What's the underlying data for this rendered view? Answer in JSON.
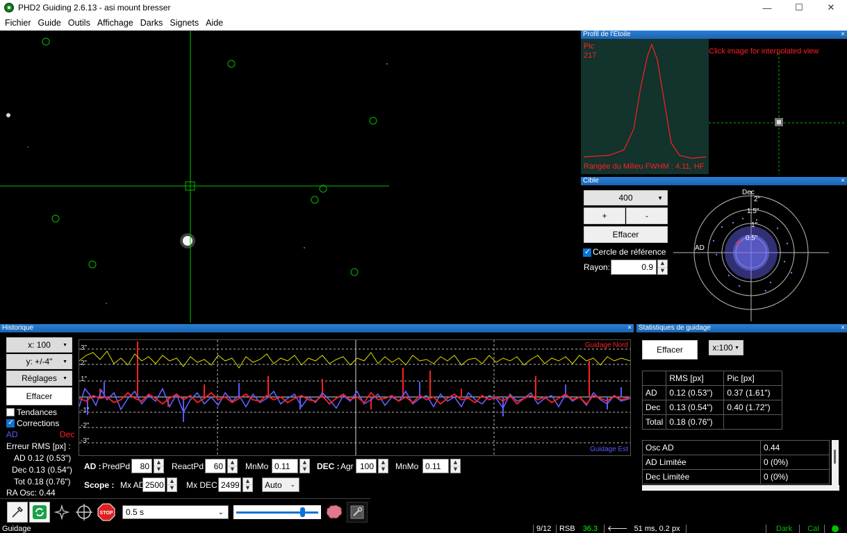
{
  "window": {
    "title": "PHD2 Guiding 2.6.13 - asi mount bresser",
    "minimize": "—",
    "maximize": "☐",
    "close": "✕"
  },
  "menu": [
    "Fichier",
    "Guide",
    "Outils",
    "Affichage",
    "Darks",
    "Signets",
    "Aide"
  ],
  "profile_panel": {
    "title": "Profil de l'Etoile",
    "close": "×",
    "peak_label": "Pic",
    "peak_value": "217",
    "click_hint": "Click image for interpolated view",
    "fwhm_text": "Rangée du Milieu FWHM : 4.11, HF"
  },
  "target_panel": {
    "title": "Cible",
    "close": "×",
    "zoom_value": "400",
    "plus": "+",
    "minus": "-",
    "clear": "Effacer",
    "ref_circle_label": "Cercle de référence",
    "ref_circle_checked": true,
    "radius_label": "Rayon:",
    "radius_value": "0.9",
    "axis_dec": "Dec",
    "axis_ra": "AD",
    "ring_labels": [
      "2\"",
      "1.5\"",
      "1\"",
      "0.5\""
    ]
  },
  "history_panel": {
    "title": "Historique",
    "close": "×",
    "x_scale": "x: 100",
    "y_scale": "y: +/-4\"",
    "settings": "Réglages",
    "clear": "Effacer",
    "trends_label": "Tendances",
    "trends_checked": false,
    "corrections_label": "Corrections",
    "corrections_checked": true,
    "legend_ra": "AD",
    "legend_dec": "Dec",
    "rms_title": "Erreur RMS [px] :",
    "rms_ra": "AD 0.12 (0.53\")",
    "rms_dec": "Dec 0.13 (0.54\")",
    "rms_tot": "Tot 0.18 (0.76\")",
    "ra_osc": "RA Osc: 0.44",
    "graph_north": "Guidage Nord",
    "graph_east": "Guidage Est",
    "y_ticks": [
      "3\"",
      "2\"",
      "1\"",
      "-1\"",
      "-2\"",
      "-3\""
    ],
    "params": {
      "ad_label": "AD :",
      "predpd_label": "PredPd",
      "predpd_value": "80",
      "reactpd_label": "ReactPd",
      "reactpd_value": "60",
      "mnmo_label": "MnMo",
      "mnmo_ra_value": "0.11",
      "dec_label": "DEC :",
      "agr_label": "Agr",
      "agr_value": "100",
      "mnmo_dec_value": "0.11",
      "scope_label": "Scope :",
      "mxad_label": "Mx AD",
      "mxad_value": "2500",
      "mxdec_label": "Mx DEC",
      "mxdec_value": "2499",
      "mode_value": "Auto"
    }
  },
  "stats_panel": {
    "title": "Statistiques de guidage",
    "close": "×",
    "clear": "Effacer",
    "x_scale": "x:100",
    "table_headers": [
      "",
      "RMS [px]",
      "Pic [px]"
    ],
    "table_rows": [
      [
        "AD",
        "0.12 (0.53\")",
        "0.37 (1.61\")"
      ],
      [
        "Dec",
        "0.13 (0.54\")",
        "0.40 (1.72\")"
      ],
      [
        "Total",
        "0.18 (0.76\")",
        ""
      ]
    ],
    "list_rows": [
      [
        "Osc AD",
        "0.44"
      ],
      [
        "AD Limitée",
        "0 (0%)"
      ],
      [
        "Dec Limitée",
        "0 (0%)"
      ]
    ]
  },
  "toolbar": {
    "exposure": "0.5 s",
    "stop_label": "STOP",
    "tools": [
      "usb-icon",
      "loop-icon",
      "auto-select-star-icon",
      "guide-icon",
      "stop-icon"
    ]
  },
  "statusbar": {
    "state": "Guidage",
    "frames": "9/12",
    "rsb_label": "RSB",
    "rsb_value": "36.3",
    "correction": "51 ms, 0.2 px",
    "dark": "Dark",
    "cal": "Cal"
  },
  "colors": {
    "ra": "#5a5aff",
    "dec": "#ff2020",
    "snr": "#ffff00",
    "accent_green": "#00c000",
    "panel_header": "#1f6fc5"
  }
}
